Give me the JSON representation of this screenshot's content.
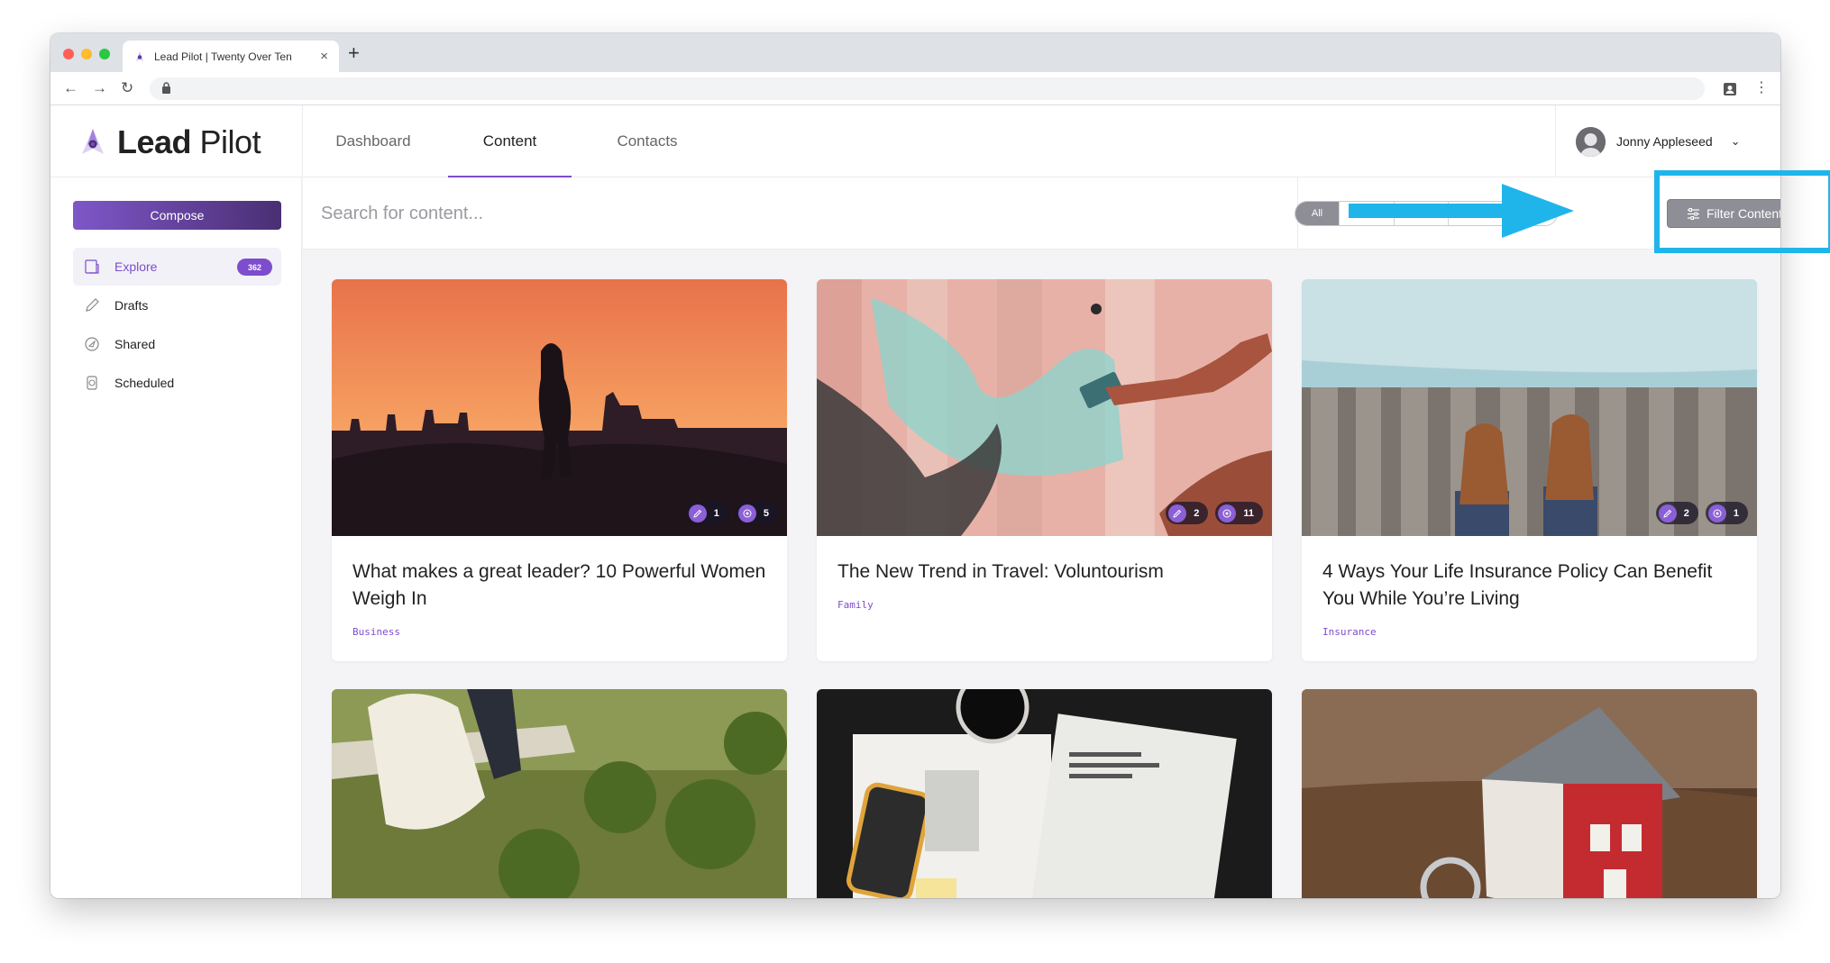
{
  "browser": {
    "tab_title": "Lead Pilot | Twenty Over Ten",
    "new_tab": "+",
    "tab_close": "×",
    "back": "←",
    "forward": "→",
    "reload": "↻",
    "menu": "⋮"
  },
  "app": {
    "logo_bold": "Lead",
    "logo_light": "Pilot",
    "accent_color": "#7c4dcc"
  },
  "nav": {
    "tabs": [
      {
        "label": "Dashboard"
      },
      {
        "label": "Content",
        "active": true
      },
      {
        "label": "Contacts"
      }
    ]
  },
  "user": {
    "name": "Jonny Appleseed",
    "chevron": "⌄"
  },
  "sidebar": {
    "compose_label": "Compose",
    "items": [
      {
        "label": "Explore",
        "icon": "explore-icon",
        "count": "362",
        "active": true
      },
      {
        "label": "Drafts",
        "icon": "pencil-icon"
      },
      {
        "label": "Shared",
        "icon": "shared-icon"
      },
      {
        "label": "Scheduled",
        "icon": "clock-icon"
      }
    ]
  },
  "search": {
    "placeholder": "Search for content...",
    "segment_all": "All"
  },
  "filter": {
    "label": "Filter Content",
    "highlight_color": "#1fb5ea"
  },
  "cards": [
    {
      "title": "What makes a great leader? 10 Powerful Women Weigh In",
      "tag": "Business",
      "edits": "1",
      "shares": "5"
    },
    {
      "title": "The New Trend in Travel: Voluntourism",
      "tag": "Family",
      "edits": "2",
      "shares": "11"
    },
    {
      "title": "4 Ways Your Life Insurance Policy Can Benefit You While You’re Living",
      "tag": "Insurance",
      "edits": "2",
      "shares": "1"
    },
    {
      "image": "wedding-couple-image"
    },
    {
      "image": "tax-documents-image"
    },
    {
      "image": "house-keys-image"
    }
  ]
}
